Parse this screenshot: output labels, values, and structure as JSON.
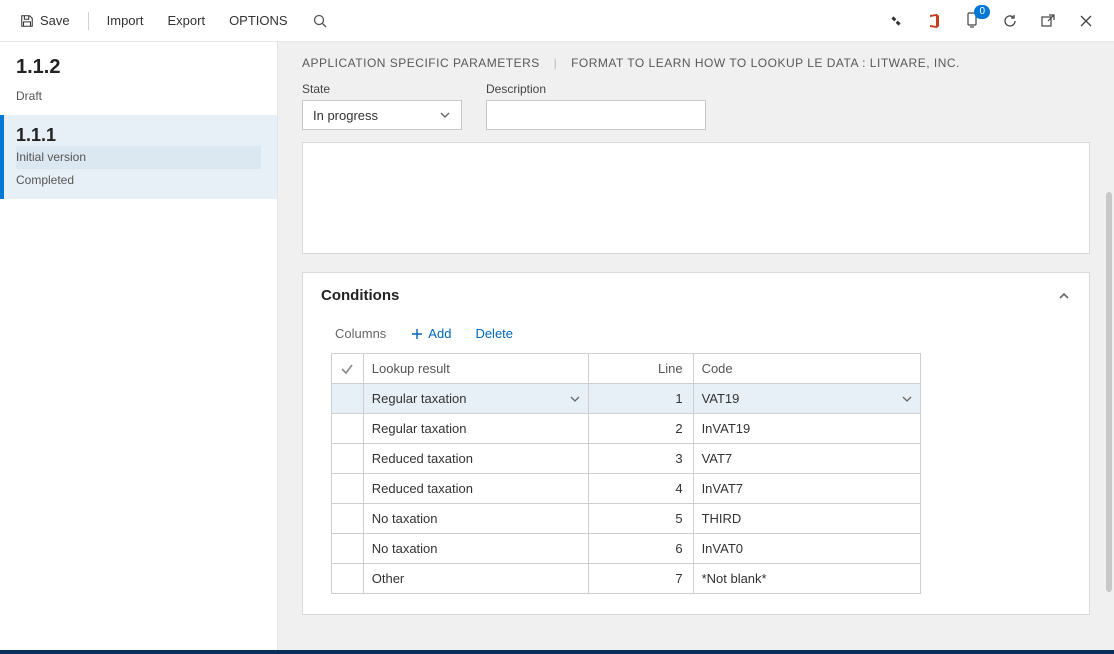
{
  "toolbar": {
    "save": "Save",
    "import": "Import",
    "export": "Export",
    "options": "OPTIONS"
  },
  "notif_count": "0",
  "sidebar": {
    "versions": [
      {
        "num": "1.1.2",
        "status": "Draft"
      },
      {
        "num": "1.1.1",
        "status1": "Initial version",
        "status2": "Completed"
      }
    ]
  },
  "header": {
    "part1": "APPLICATION SPECIFIC PARAMETERS",
    "part2": "FORMAT TO LEARN HOW TO LOOKUP LE DATA : LITWARE, INC."
  },
  "fields": {
    "state_label": "State",
    "state_value": "In progress",
    "desc_label": "Description",
    "desc_value": ""
  },
  "conditions": {
    "title": "Conditions",
    "toolbar": {
      "columns": "Columns",
      "add": "Add",
      "delete": "Delete"
    },
    "headers": {
      "lookup": "Lookup result",
      "line": "Line",
      "code": "Code"
    },
    "rows": [
      {
        "lookup": "Regular taxation",
        "line": "1",
        "code": "VAT19",
        "selected": true
      },
      {
        "lookup": "Regular taxation",
        "line": "2",
        "code": "InVAT19"
      },
      {
        "lookup": "Reduced taxation",
        "line": "3",
        "code": "VAT7"
      },
      {
        "lookup": "Reduced taxation",
        "line": "4",
        "code": "InVAT7"
      },
      {
        "lookup": "No taxation",
        "line": "5",
        "code": "THIRD"
      },
      {
        "lookup": "No taxation",
        "line": "6",
        "code": "InVAT0"
      },
      {
        "lookup": "Other",
        "line": "7",
        "code": "*Not blank*"
      }
    ]
  }
}
